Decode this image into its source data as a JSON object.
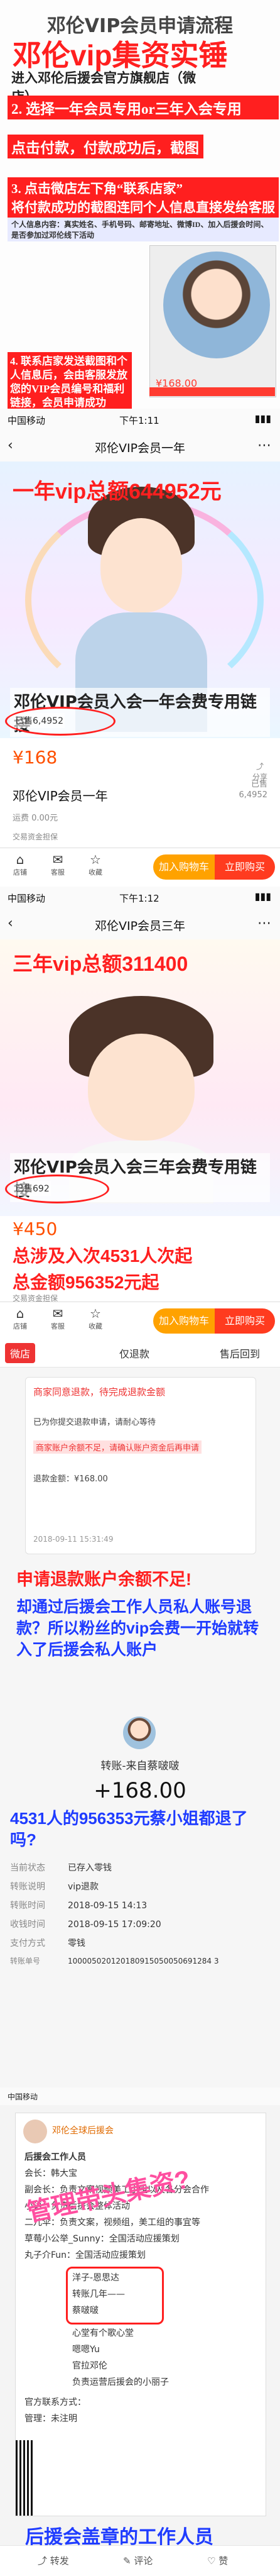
{
  "section1": {
    "title": "邓伦VIP会员申请流程",
    "overlay": "邓伦vip集资实锤",
    "step1": "进入邓伦后援会官方旗舰店（微店）",
    "step2": "2. 选择一年会员专用or三年入会专用",
    "step3": "点击付款，付款成功后，截图",
    "step4": "3. 点击微店左下角“联系店家”",
    "step4b": "将付款成功的截图连同个人信息直接发给客服",
    "step5": "个人信息内容：真实姓名、手机号码、邮寄地址、微博ID、加入后援会时间、是否参加过邓伦线下活动",
    "foot": "4. 联系店家发送截图和个人信息后，会由客服发放您的VIP会员编号和福利链接，会员申请成功",
    "mini_price": "¥168.00"
  },
  "page1": {
    "time": "下午1:11",
    "carrier": "中国移动",
    "nav_title": "邓伦VIP会员一年",
    "overlay": "一年vip总额644952元",
    "banner": "邓伦VIP会员入会一年会费专用链接",
    "sold_label": "已售6,4952",
    "price": "¥168",
    "product_name": "邓伦VIP会员一年",
    "sold_right": "已售\n6,4952",
    "share": "分享",
    "freight": "运费 0.00元",
    "protect": "交易资金担保",
    "shop_icons": [
      "店铺",
      "客服",
      "收藏"
    ],
    "cart": "加入购物车",
    "buy": "立即购买"
  },
  "page3": {
    "time": "下午1:12",
    "carrier": "中国移动",
    "nav_title": "邓伦VIP会员三年",
    "overlay": "三年vip总额311400",
    "banner": "邓伦VIP会员入会三年会费专用链接",
    "sold_label": "已售692",
    "price": "¥450",
    "total1": "总涉及入次4531人次起",
    "total2": "总金额956352元起",
    "protect": "交易资金担保",
    "shop_icons": [
      "店铺",
      "客服",
      "收藏"
    ],
    "cart": "加入购物车",
    "buy": "立即购买"
  },
  "refund": {
    "tabs": [
      "微店",
      "仅退款",
      "售后回到"
    ],
    "card_title": "商家同意退款，待完成退款金额",
    "card_lines": [
      "已为你提交退款申请，请耐心等待",
      "商家账户余额不足，请确认账户资金后再申请",
      "退款金额：¥168.00"
    ],
    "note1": "申请退款账户余额不足!",
    "note2": "却通过后援会工作人员私人账号退款？所以粉丝的vip会费一开始就转入了后援会私人账户",
    "transfer_title": "转账-来自蔡啵啵",
    "amount": "+168.00",
    "question": "4531人的956353元蔡小姐都退了吗?",
    "rows": [
      {
        "k": "当前状态",
        "v": "已存入零钱"
      },
      {
        "k": "转账说明",
        "v": "vip退款"
      },
      {
        "k": "转账时间",
        "v": "2018-09-15 14:13"
      },
      {
        "k": "收钱时间",
        "v": "2018-09-15 17:09:20"
      },
      {
        "k": "支付方式",
        "v": "零钱"
      },
      {
        "k": "转账单号",
        "v": "100005020120180915050050691284 3"
      }
    ],
    "date_line": "2018-09-11 15:31:49"
  },
  "weibo": {
    "carrier": "中国移动",
    "user": "邓伦全球后援会",
    "overlay": "管理带头集资?",
    "lines": [
      "后援会工作人员",
      "会长：韩大宝",
      "副会长：负责文案视频美工小组以及各分会合作",
      "小语：负责后援会整体活动",
      "二儿伞：负责文案，视频组，美工组的事宜等",
      "草莓小公举_Sunny：全国活动应援策划",
      "丸子介Fun：全国活动应援策划",
      "洋子-恩思达",
      "转账几年——",
      "蔡啵啵",
      "心堂有个歌心堂",
      "嗯嗯Yu",
      "官拉邓伦",
      "负责运营后援会的小丽子",
      "官方联系方式：",
      "管理：未注明"
    ],
    "bottom_note": "后援会盖章的工作人员",
    "actions": [
      "转发",
      "评论",
      "赞"
    ]
  }
}
